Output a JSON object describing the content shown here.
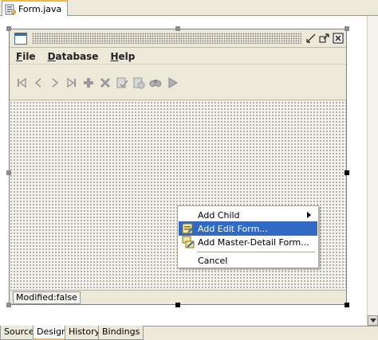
{
  "file_tab": {
    "label": "Form.java",
    "icon": "java-file-icon"
  },
  "menubar": {
    "items": [
      {
        "label": "File",
        "mnemonic": "F",
        "rest": "ile"
      },
      {
        "label": "Database",
        "mnemonic": "D",
        "rest": "atabase"
      },
      {
        "label": "Help",
        "mnemonic": "H",
        "rest": "elp"
      }
    ]
  },
  "toolbar": {
    "buttons": [
      "first-record-icon",
      "previous-record-icon",
      "next-record-icon",
      "last-record-icon",
      "insert-record-icon",
      "delete-record-icon",
      "commit-icon",
      "rollback-icon",
      "find-icon",
      "execute-icon"
    ]
  },
  "status": {
    "text": "Modified:false"
  },
  "context_menu": {
    "items": [
      {
        "label": "Add Child",
        "has_submenu": true
      },
      {
        "label": "Add Edit Form...",
        "icon": "edit-form-icon",
        "selected": true
      },
      {
        "label": "Add Master-Detail Form...",
        "icon": "master-detail-form-icon"
      },
      {
        "label": "Cancel"
      }
    ]
  },
  "bottom_tabs": [
    {
      "label": "Source"
    },
    {
      "label": "Design",
      "active": true
    },
    {
      "label": "History"
    },
    {
      "label": "Bindings"
    }
  ],
  "colors": {
    "selection": "#316ac5",
    "active_tab_accent": "#f5b54a",
    "chrome": "#ece9d8"
  }
}
